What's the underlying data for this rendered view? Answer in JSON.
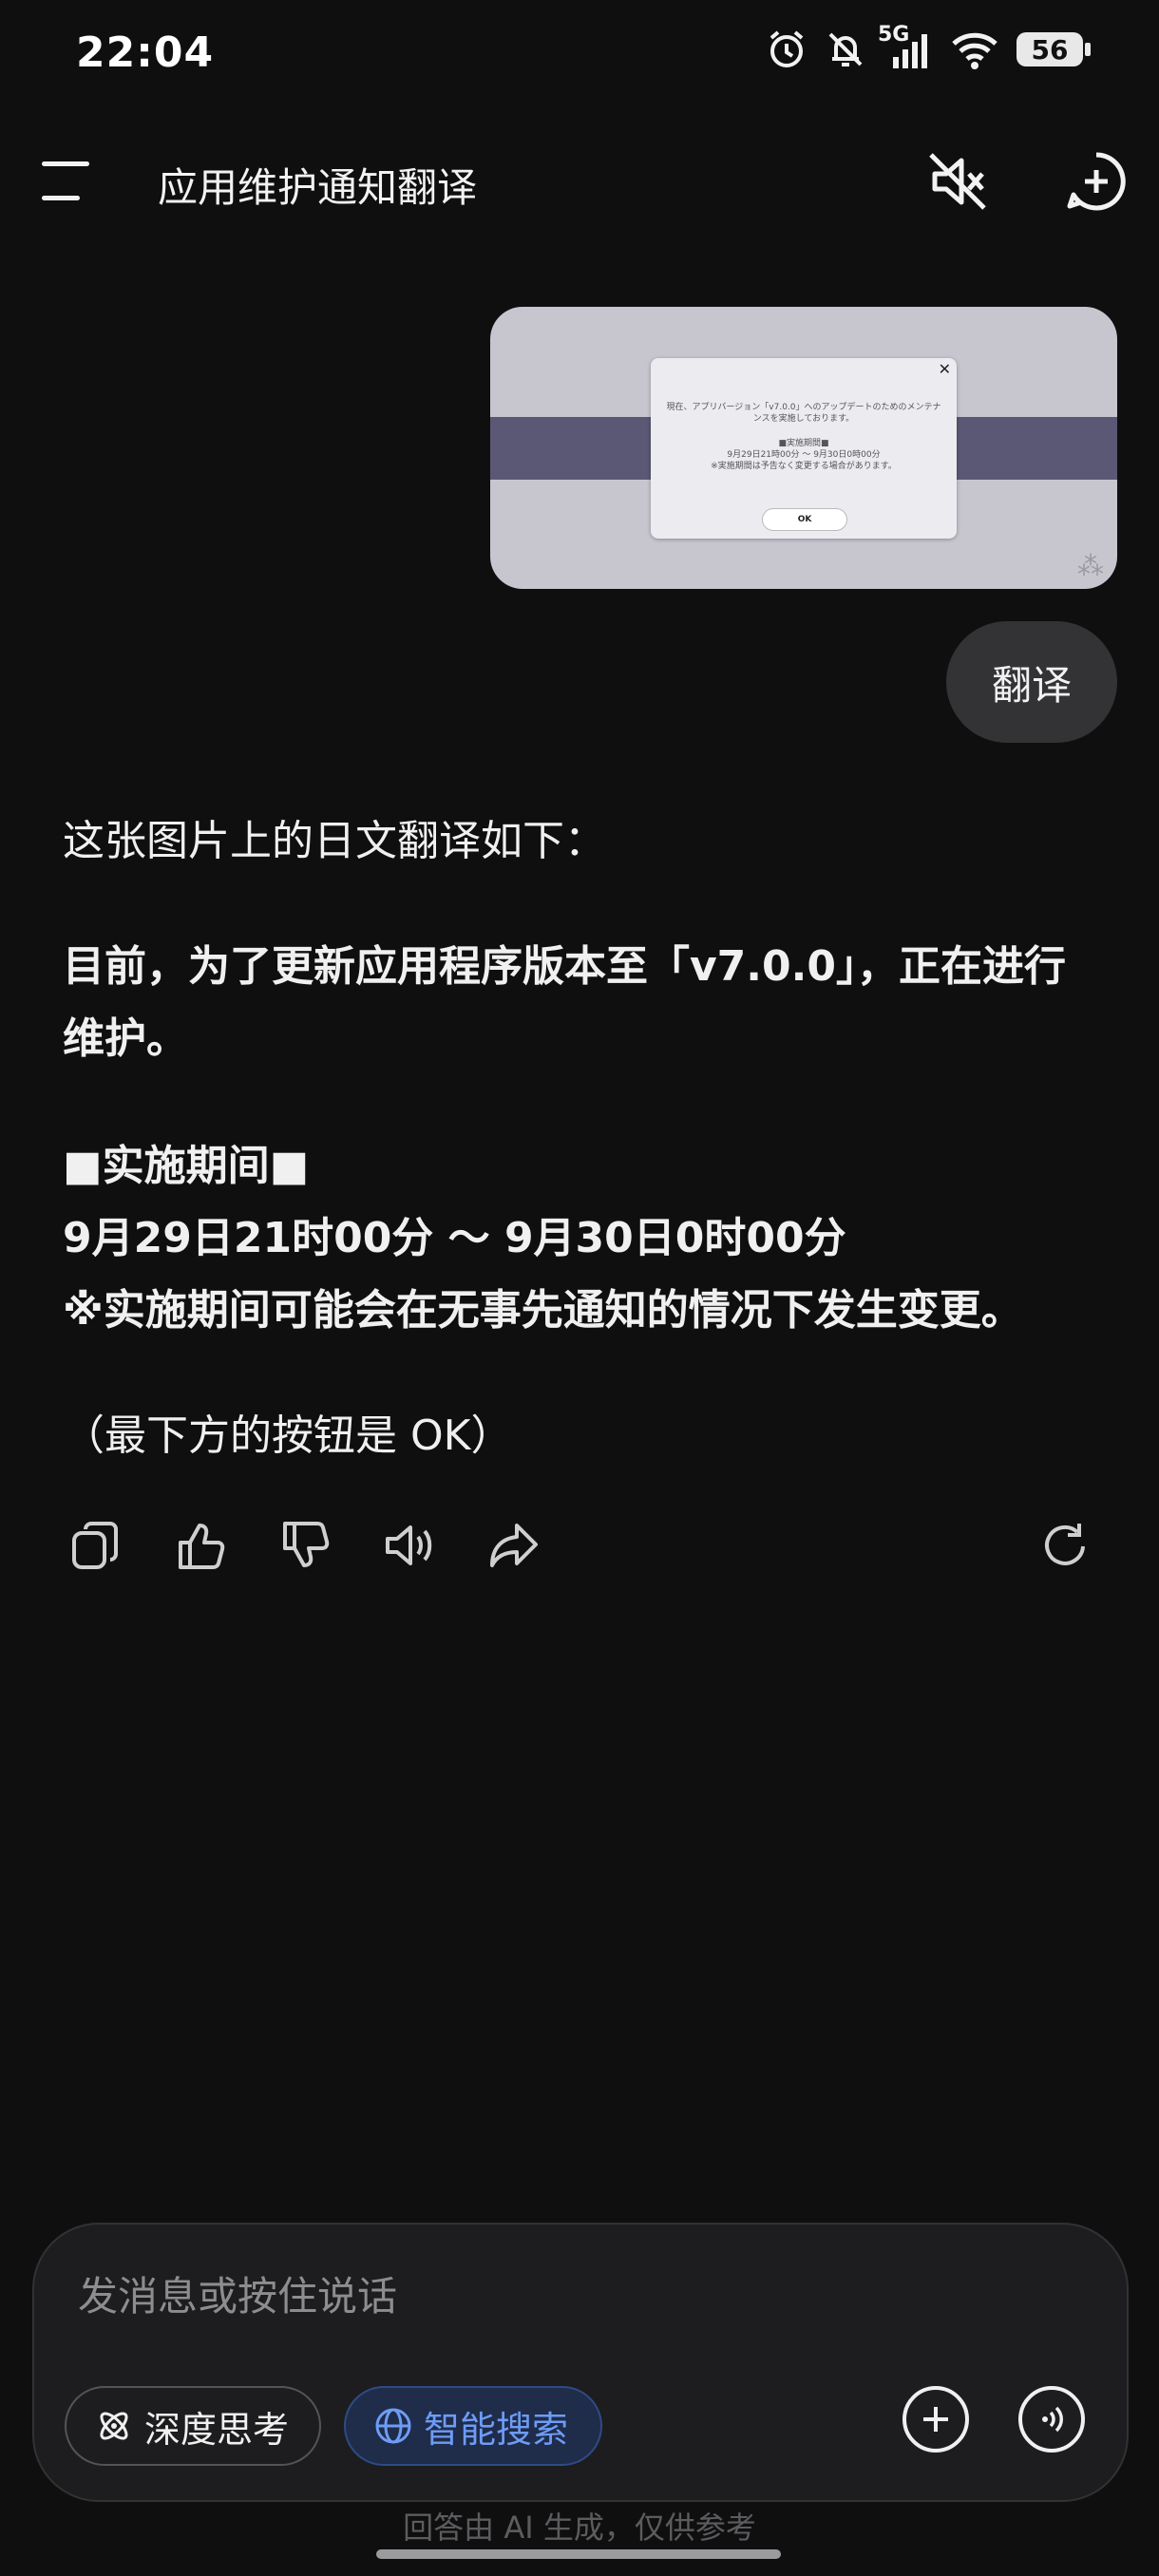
{
  "status_bar": {
    "time": "22:04",
    "network": "5G",
    "battery": "56"
  },
  "header": {
    "title": "应用维护通知翻译"
  },
  "attachment": {
    "dialog_line1": "現在、アプリバージョン「v7.0.0」へのアップデートのためのメンテナ",
    "dialog_line2": "ンスを実施しております。",
    "dialog_line3": "■実施期間■",
    "dialog_line4": "9月29日21時00分 〜 9月30日0時00分",
    "dialog_line5": "※実施期間は予告なく変更する場合があります。",
    "dialog_ok": "OK",
    "dialog_close": "✕"
  },
  "user_message": "翻译",
  "answer": {
    "intro": "这张图片上的日文翻译如下：",
    "p1_line1": "目前，为了更新应用程序版本至「v7.0.0」，正在进行",
    "p1_line2": "维护。",
    "period_heading": "■实施期间■",
    "period_time": "9月29日21时00分 ～ 9月30日0时00分",
    "period_note": "※实施期间可能会在无事先通知的情况下发生变更。",
    "footer_note": "（最下方的按钮是 OK）"
  },
  "input": {
    "placeholder": "发消息或按住说话",
    "deep_think": "深度思考",
    "smart_search": "智能搜索"
  },
  "disclaimer": "回答由 AI 生成，仅供参考",
  "colors": {
    "background": "#0f0f10",
    "accent": "#6d9cf5",
    "bubble": "#333335"
  }
}
